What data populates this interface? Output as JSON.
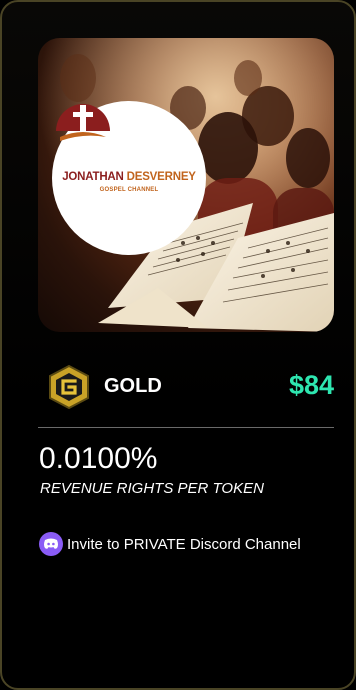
{
  "hero": {
    "logo_name_part1": "JONATHAN ",
    "logo_name_part2": "DESVERNEY",
    "logo_subtitle": "GOSPEL CHANNEL"
  },
  "tier": {
    "icon": "gold-coin-icon",
    "name": "GOLD",
    "price": "$84"
  },
  "rights": {
    "value": "0.0100%",
    "label": "REVENUE RIGHTS PER TOKEN"
  },
  "perks": [
    {
      "icon": "discord-icon",
      "text": "Invite to PRIVATE Discord Channel"
    }
  ],
  "colors": {
    "price": "#2ee6b0",
    "discord": "#8a5cf6",
    "logo_red": "#8b1e1e",
    "logo_orange": "#c1641d",
    "card_border": "#4a4425"
  }
}
